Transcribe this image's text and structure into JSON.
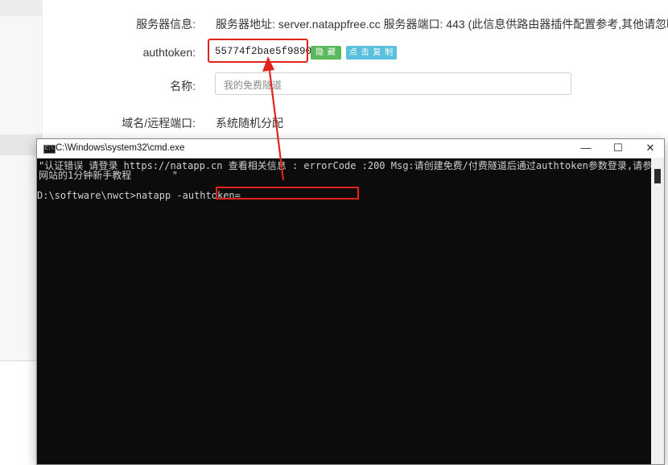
{
  "form": {
    "server_info_label": "服务器信息:",
    "server_info_value": "服务器地址: server.natappfree.cc 服务器端口: 443 (此信息供路由器插件配置参考,其他请忽略)",
    "authtoken_label": "authtoken:",
    "authtoken_value": "55774f2bae5f9890",
    "hide_button": "隐 藏",
    "copy_button": "点 击 复 制",
    "name_label": "名称:",
    "name_input_value": "我的免费隧道",
    "domain_label": "域名/远程端口:",
    "domain_value": "系统随机分配"
  },
  "cmd": {
    "title": "C:\\Windows\\system32\\cmd.exe",
    "icon_text": "C:\\",
    "minimize_icon": "—",
    "maximize_icon": "☐",
    "close_icon": "✕",
    "line1": "\"认证错误 请登录 https://natapp.cn 查看相关信息 : errorCode :200 Msg:请创建免费/付费隧道后通过authtoken参数登录,请参考",
    "line2": "网站的1分钟新手教程       \"",
    "prompt": "D:\\software\\nwct>natapp -authtoken="
  },
  "colors": {
    "highlight": "#e0241c",
    "hide_button": "#5cb85c",
    "copy_button": "#5bc0de",
    "console_bg": "#0c0c0c"
  }
}
